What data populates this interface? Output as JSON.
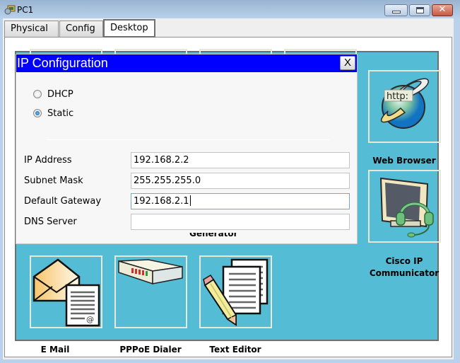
{
  "window": {
    "title": "PC1",
    "icon": "pc-magnifier-icon",
    "controls": {
      "minimize": "minimize",
      "maximize": "maximize",
      "close": "close"
    }
  },
  "tabs": [
    {
      "label": "Physical",
      "active": false
    },
    {
      "label": "Config",
      "active": false
    },
    {
      "label": "Desktop",
      "active": true
    }
  ],
  "desktop": {
    "background_color": "#54bcd4",
    "apps": [
      {
        "label": "Web Browser",
        "icon": "web-browser-icon",
        "icon_text": "http:"
      },
      {
        "label": "Cisco IP Communicator",
        "label_line1": "Cisco IP",
        "label_line2": "Communicator",
        "icon": "ip-communicator-icon"
      },
      {
        "label": "E Mail",
        "icon": "email-icon"
      },
      {
        "label": "PPPoE Dialer",
        "icon": "pppoe-dialer-icon"
      },
      {
        "label": "Text Editor",
        "icon": "text-editor-icon"
      },
      {
        "label": "Generator",
        "partially_hidden": true
      }
    ]
  },
  "ip_config": {
    "title": "IP Configuration",
    "close_label": "X",
    "title_color": "#0000ff",
    "mode_options": [
      {
        "label": "DHCP",
        "selected": false
      },
      {
        "label": "Static",
        "selected": true
      }
    ],
    "fields": [
      {
        "label": "IP Address",
        "value": "192.168.2.2"
      },
      {
        "label": "Subnet Mask",
        "value": "255.255.255.0"
      },
      {
        "label": "Default Gateway",
        "value": "192.168.2.1",
        "focused": true
      },
      {
        "label": "DNS Server",
        "value": ""
      }
    ]
  }
}
